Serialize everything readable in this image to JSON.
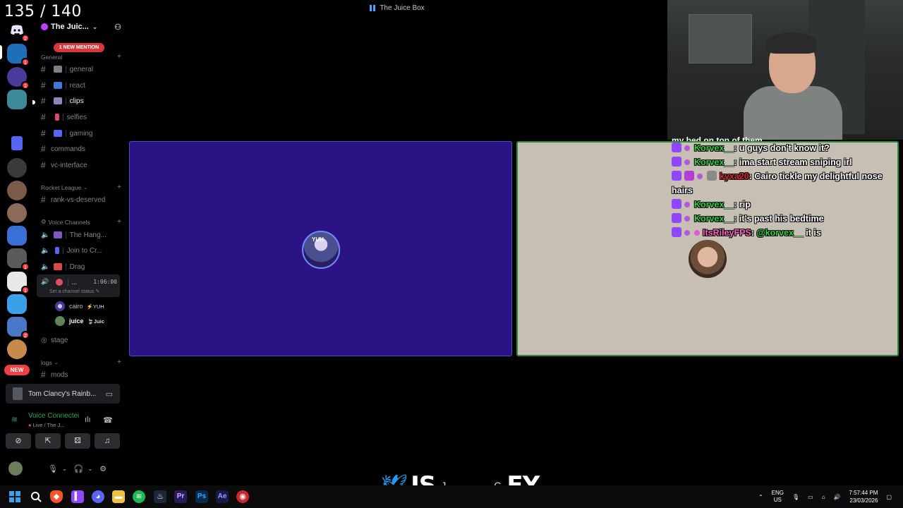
{
  "counter": "135 / 140",
  "window": {
    "title": "The Juice Box"
  },
  "server_rail": {
    "new_label": "NEW",
    "servers": [
      {
        "name": "discord-home-icon",
        "badge": "2"
      },
      {
        "name": "server-1",
        "badge": "1"
      },
      {
        "name": "server-2",
        "badge": "1"
      },
      {
        "name": "server-3",
        "badge": ""
      },
      {
        "name": "server-4",
        "badge": ""
      },
      {
        "name": "server-5",
        "badge": ""
      },
      {
        "name": "server-6",
        "badge": ""
      },
      {
        "name": "server-7",
        "badge": ""
      },
      {
        "name": "server-8",
        "badge": "1"
      },
      {
        "name": "server-9",
        "badge": "1"
      },
      {
        "name": "server-10",
        "badge": ""
      },
      {
        "name": "server-11",
        "badge": "2"
      },
      {
        "name": "server-12",
        "badge": ""
      }
    ]
  },
  "guild": {
    "name": "The Juic...",
    "mention_banner": "1 NEW MENTION"
  },
  "categories": {
    "general": "General",
    "rocket_league": "Rocket League",
    "voice": "Voice Channels",
    "logs": "logs"
  },
  "channels": {
    "general": "general",
    "react": "react",
    "clips": "clips",
    "selfies": "selfies",
    "gaming": "gaming",
    "commands": "commands",
    "vc_interface": "vc-interface",
    "rank_vs_deserved": "rank-vs-deserved",
    "mods": "mods"
  },
  "voice_channels": {
    "hang": "The Hang...",
    "join": "Join to Cr...",
    "drag": "Drag",
    "active_name": "...",
    "active_time": "1:06:00",
    "channel_status": "Set a channel status",
    "stage": "stage"
  },
  "members": [
    {
      "name": "cairo",
      "tag": "YUH"
    },
    {
      "name": "juice",
      "tag": "Juic"
    }
  ],
  "activity": {
    "game": "Tom Clancy's Rainb..."
  },
  "voice_panel": {
    "title": "Voice Connected",
    "subtitle": "Live / The J..."
  },
  "stage": {
    "left_avatar_text": "YUH"
  },
  "chat": {
    "cut_line": "my bed on top of them",
    "messages": [
      {
        "user": "Korvex__",
        "text": ": u guys don't know it?"
      },
      {
        "user": "Korvex__",
        "text": ": ima start stream sniping irl"
      },
      {
        "user": "kyxa20",
        "text": ": Cairo tickle my delightful nose hairs"
      },
      {
        "user": "Korvex__",
        "text": ": rip"
      },
      {
        "user": "Korvex__",
        "text": ": it's past his bedtime"
      },
      {
        "user": "ItsRileyFPS",
        "text": ": ",
        "mention": "@korvex__",
        "after": " it is"
      }
    ]
  },
  "bottom_overlay": {
    "left": "IS",
    "mid_small_1": "J",
    "mid_small_2": "C",
    "right": "EY"
  },
  "taskbar": {
    "lang_top": "ENG",
    "lang_bottom": "US",
    "time": "7:57:44 PM",
    "date": "23/03/2026",
    "apps": [
      "windows-start-icon",
      "search-icon",
      "brave-icon",
      "twitch-icon",
      "discord-icon",
      "file-explorer-icon",
      "spotify-icon",
      "steam-icon",
      "premiere-icon",
      "photoshop-icon",
      "after-effects-icon",
      "obs-icon"
    ]
  },
  "colors": {
    "stage_left_bg": "#2b1385",
    "stage_right_bg": "#c7bfb3",
    "twitch_purple": "#9146ff",
    "discord_red": "#f23f43",
    "voice_green": "#23a55a"
  }
}
